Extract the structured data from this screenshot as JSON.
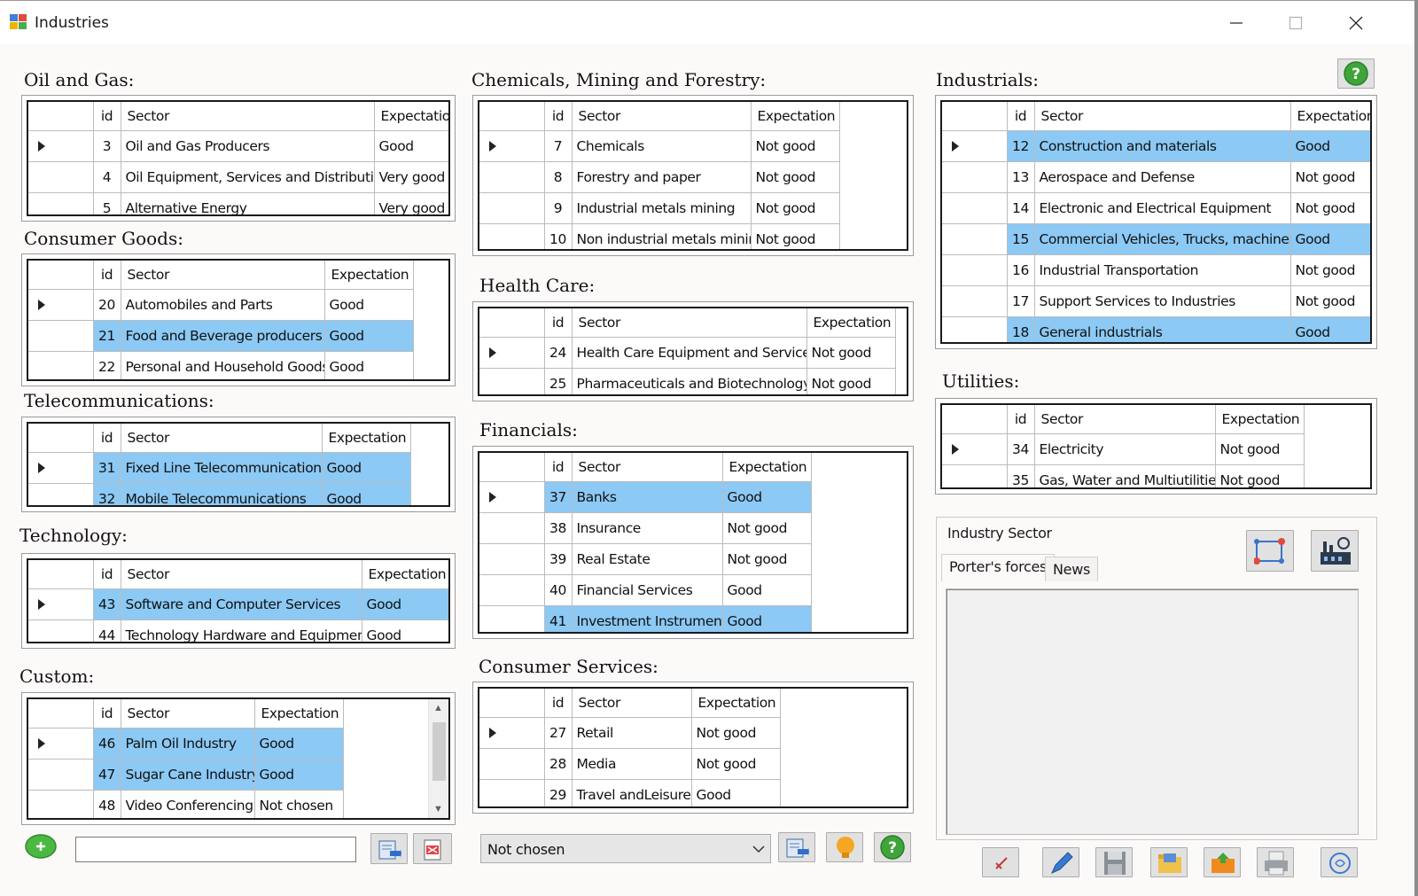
{
  "window": {
    "title": "Industries"
  },
  "columns": {
    "id": "id",
    "sector": "Sector",
    "expectation": "Expectation"
  },
  "grids": {
    "oil_gas": {
      "title": "Oil and Gas:",
      "rows": [
        {
          "id": "3",
          "sector": "Oil and Gas Producers",
          "expectation": "Good",
          "selected": false,
          "current": true
        },
        {
          "id": "4",
          "sector": "Oil Equipment, Services and Distribution",
          "expectation": "Very good",
          "selected": false,
          "current": false
        },
        {
          "id": "5",
          "sector": "Alternative Energy",
          "expectation": "Very good",
          "selected": false,
          "current": false
        }
      ]
    },
    "consumer_goods": {
      "title": "Consumer Goods:",
      "rows": [
        {
          "id": "20",
          "sector": "Automobiles and Parts",
          "expectation": "Good",
          "selected": false,
          "current": true
        },
        {
          "id": "21",
          "sector": "Food and Beverage producers",
          "expectation": "Good",
          "selected": true,
          "current": false
        },
        {
          "id": "22",
          "sector": "Personal and Household Goods",
          "expectation": "Good",
          "selected": false,
          "current": false
        }
      ]
    },
    "telecom": {
      "title": "Telecommunications:",
      "rows": [
        {
          "id": "31",
          "sector": "Fixed Line Telecommunications",
          "expectation": "Good",
          "selected": true,
          "current": true
        },
        {
          "id": "32",
          "sector": "Mobile Telecommunications",
          "expectation": "Good",
          "selected": true,
          "current": false
        }
      ]
    },
    "technology": {
      "title": "Technology:",
      "rows": [
        {
          "id": "43",
          "sector": "Software and Computer Services",
          "expectation": "Good",
          "selected": true,
          "current": true
        },
        {
          "id": "44",
          "sector": "Technology Hardware and Equipment",
          "expectation": "Good",
          "selected": false,
          "current": false
        }
      ]
    },
    "custom": {
      "title": "Custom:",
      "rows": [
        {
          "id": "46",
          "sector": "Palm Oil Industry",
          "expectation": "Good",
          "selected": true,
          "current": true
        },
        {
          "id": "47",
          "sector": "Sugar Cane Industry",
          "expectation": "Good",
          "selected": true,
          "current": false
        },
        {
          "id": "48",
          "sector": "Video Conferencing",
          "expectation": "Not chosen",
          "selected": false,
          "current": false
        }
      ]
    },
    "chemicals": {
      "title": "Chemicals, Mining and Forestry:",
      "rows": [
        {
          "id": "7",
          "sector": "Chemicals",
          "expectation": "Not good",
          "selected": false,
          "current": true
        },
        {
          "id": "8",
          "sector": "Forestry and paper",
          "expectation": "Not good",
          "selected": false,
          "current": false
        },
        {
          "id": "9",
          "sector": "Industrial metals mining",
          "expectation": "Not good",
          "selected": false,
          "current": false
        },
        {
          "id": "10",
          "sector": "Non industrial metals mining",
          "expectation": "Not good",
          "selected": false,
          "current": false
        }
      ]
    },
    "health": {
      "title": "Health Care:",
      "rows": [
        {
          "id": "24",
          "sector": "Health Care Equipment and Services",
          "expectation": "Not good",
          "selected": false,
          "current": true
        },
        {
          "id": "25",
          "sector": "Pharmaceuticals and Biotechnology",
          "expectation": "Not good",
          "selected": false,
          "current": false
        }
      ]
    },
    "financials": {
      "title": "Financials:",
      "rows": [
        {
          "id": "37",
          "sector": "Banks",
          "expectation": "Good",
          "selected": true,
          "current": true
        },
        {
          "id": "38",
          "sector": "Insurance",
          "expectation": "Not good",
          "selected": false,
          "current": false
        },
        {
          "id": "39",
          "sector": "Real Estate",
          "expectation": "Not good",
          "selected": false,
          "current": false
        },
        {
          "id": "40",
          "sector": "Financial Services",
          "expectation": "Good",
          "selected": false,
          "current": false
        },
        {
          "id": "41",
          "sector": "Investment Instruments",
          "expectation": "Good",
          "selected": true,
          "current": false
        }
      ]
    },
    "consumer_services": {
      "title": "Consumer Services:",
      "rows": [
        {
          "id": "27",
          "sector": "Retail",
          "expectation": "Not good",
          "selected": false,
          "current": true
        },
        {
          "id": "28",
          "sector": "Media",
          "expectation": "Not good",
          "selected": false,
          "current": false
        },
        {
          "id": "29",
          "sector": "Travel andLeisure",
          "expectation": "Good",
          "selected": false,
          "current": false
        }
      ]
    },
    "industrials": {
      "title": "Industrials:",
      "rows": [
        {
          "id": "12",
          "sector": "Construction and materials",
          "expectation": "Good",
          "selected": true,
          "current": true
        },
        {
          "id": "13",
          "sector": "Aerospace and Defense",
          "expectation": "Not good",
          "selected": false,
          "current": false
        },
        {
          "id": "14",
          "sector": "Electronic and Electrical Equipment",
          "expectation": "Not good",
          "selected": false,
          "current": false
        },
        {
          "id": "15",
          "sector": "Commercial Vehicles, Trucks, machinery",
          "expectation": "Good",
          "selected": true,
          "current": false
        },
        {
          "id": "16",
          "sector": "Industrial Transportation",
          "expectation": "Not good",
          "selected": false,
          "current": false
        },
        {
          "id": "17",
          "sector": "Support Services to Industries",
          "expectation": "Not good",
          "selected": false,
          "current": false
        },
        {
          "id": "18",
          "sector": "General industrials",
          "expectation": "Good",
          "selected": true,
          "current": false
        }
      ]
    },
    "utilities": {
      "title": "Utilities:",
      "rows": [
        {
          "id": "34",
          "sector": "Electricity",
          "expectation": "Not good",
          "selected": false,
          "current": true
        },
        {
          "id": "35",
          "sector": "Gas, Water and Multiutilities",
          "expectation": "Not good",
          "selected": false,
          "current": false
        }
      ]
    }
  },
  "industry_panel": {
    "title": "Industry Sector",
    "tabs": [
      "Porter's forces",
      "News"
    ],
    "active_tab": "Porter's forces"
  },
  "bottom": {
    "name_input_value": "",
    "expectation_select_value": "Not chosen"
  },
  "colors": {
    "selection": "#8cc9f5",
    "background": "#fcf9f9",
    "help_green": "#3fa53a"
  }
}
